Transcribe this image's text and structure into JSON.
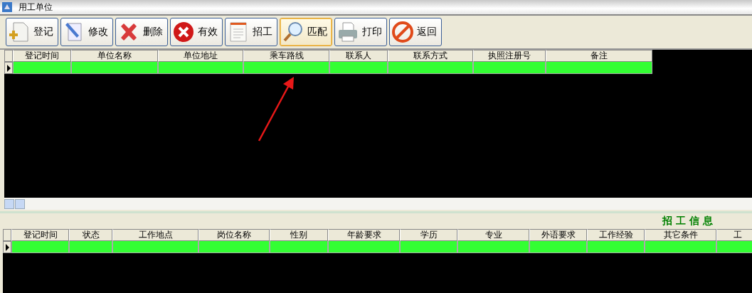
{
  "window": {
    "title": "用工单位"
  },
  "toolbar": [
    {
      "label": "登记",
      "kind": "add"
    },
    {
      "label": "修改",
      "kind": "edit"
    },
    {
      "label": "删除",
      "kind": "delete"
    },
    {
      "label": "有效",
      "kind": "valid"
    },
    {
      "label": "招工",
      "kind": "recruit"
    },
    {
      "label": "匹配",
      "kind": "match",
      "selected": true
    },
    {
      "label": "打印",
      "kind": "print"
    },
    {
      "label": "返回",
      "kind": "back"
    }
  ],
  "employer_table": {
    "columns": [
      "登记时间",
      "单位名称",
      "单位地址",
      "乘车路线",
      "联系人",
      "联系方式",
      "执照注册号",
      "备注"
    ],
    "rows": [
      {
        "current": true
      }
    ]
  },
  "annotation": {
    "kind": "arrow"
  },
  "recruitment_panel": {
    "title": "招 工 信 息"
  },
  "recruitment_table": {
    "columns": [
      "登记时间",
      "状态",
      "工作地点",
      "岗位名称",
      "性别",
      "年龄要求",
      "学历",
      "专业",
      "外语要求",
      "工作经验",
      "其它条件",
      "工"
    ],
    "rows": [
      {
        "current": true
      }
    ]
  }
}
